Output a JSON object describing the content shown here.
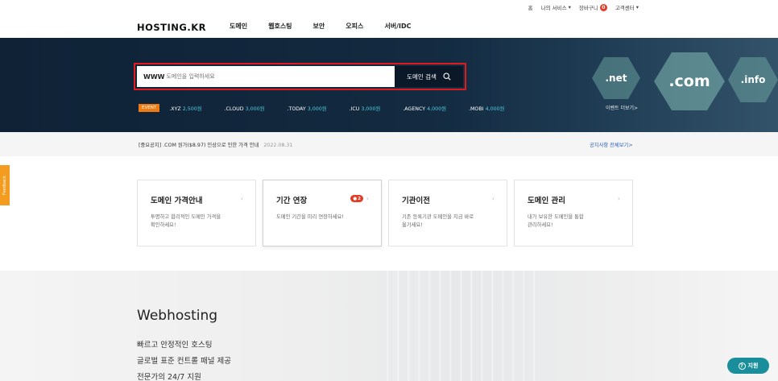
{
  "util": {
    "home": "홈",
    "my_service": "나의 서비스",
    "cart": "장바구니",
    "cart_count": "0",
    "support_center": "고객센터"
  },
  "nav": {
    "logo": "HOSTING.KR",
    "menu": [
      "도메인",
      "웹호스팅",
      "보안",
      "오피스",
      "서버/IDC"
    ]
  },
  "hero": {
    "www": "WWW",
    "search_placeholder": "도메인을 입력하세요",
    "search_button": "도메인 검색",
    "hex_labels": [
      ".net",
      ".com",
      ".info"
    ],
    "event_badge": "EVENT",
    "promos": [
      {
        "tld": ".XYZ",
        "price": "2,500원"
      },
      {
        "tld": ".CLOUD",
        "price": "3,000원"
      },
      {
        "tld": ".TODAY",
        "price": "3,000원"
      },
      {
        "tld": ".ICU",
        "price": "3,000원"
      },
      {
        "tld": ".AGENCY",
        "price": "4,000원"
      },
      {
        "tld": ".MOBI",
        "price": "4,000원"
      }
    ],
    "event_more": "이벤트 더보기>"
  },
  "notice": {
    "text": "[중요공지] .COM 원가($8.97) 인상으로 인한 가격 안내",
    "date": "2022.08.31",
    "more": "공지사항 전체보기>"
  },
  "feedback": "Feedback",
  "cards": [
    {
      "title": "도메인 가격안내",
      "desc1": "투명하고 합리적인 도메인 가격을",
      "desc2": "확인하세요!"
    },
    {
      "title": "기간 연장",
      "desc1": "도메인 기간을 미리 연장하세요!",
      "desc2": "",
      "badge": "2"
    },
    {
      "title": "기관이전",
      "desc1": "기존 등록기관 도메인을 지금 바로",
      "desc2": "옮기세요!"
    },
    {
      "title": "도메인 관리",
      "desc1": "내가 보유한 도메인을 통합",
      "desc2": "관리하세요!"
    }
  ],
  "webhosting": {
    "title": "Webhosting",
    "lines": [
      "빠르고 안정적인 호스팅",
      "글로벌 표준 컨트롤 패널 제공",
      "전문가의 24/7 지원"
    ]
  },
  "support_button": "지원"
}
